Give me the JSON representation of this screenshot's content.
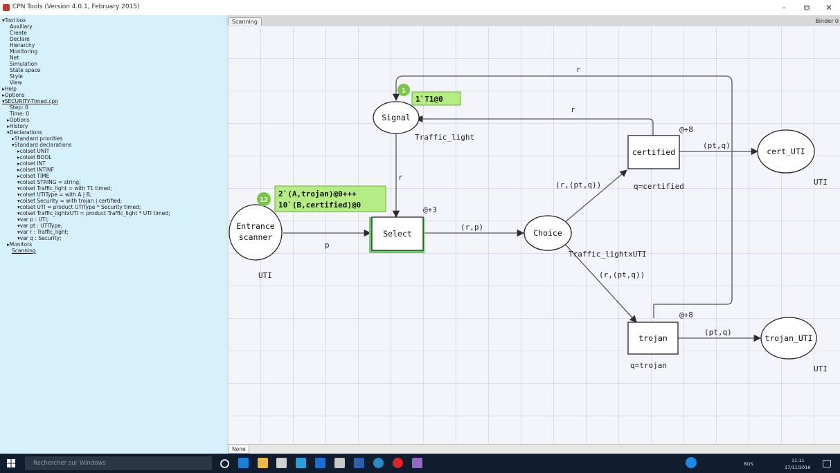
{
  "window": {
    "title": "CPN Tools (Version 4.0.1, February 2015)"
  },
  "sidebar": {
    "items": [
      "▾Tool box",
      "Auxiliary",
      "Create",
      "Declare",
      "Hierarchy",
      "Monitoring",
      "Net",
      "Simulation",
      "State space",
      "Style",
      "View",
      "▸Help",
      "▸Options",
      "▾SECURITY-Timed.cpn",
      "Step: 0",
      "Time: 0",
      "▸Options",
      "▸History",
      "▾Declarations",
      "▸Standard priorities",
      "▾Standard declarations",
      "▸colset UNIT",
      "▸colset BOOL",
      "▸colset INT",
      "▸colset INTINF",
      "▸colset TIME",
      "▾colset STRING = string;",
      "▾colset Traffic_light = with T1 timed;",
      "▾colset UTIType = with A | B;",
      "▾colset Security = with trojan | certified;",
      "▾colset UTI = product UTIType * Security timed;",
      "▾colset Traffic_lightxUTI = product Traffic_light * UTI timed;",
      "▾var p : UTI;",
      "▾var pt : UTIType;",
      "▾var r : Traffic_light;",
      "▾var q : Security;",
      "▸Monitors",
      "Scanning"
    ]
  },
  "tabs": {
    "active": "Scanning",
    "right": "Binder 0",
    "bottom": "None"
  },
  "net": {
    "places": {
      "signal": "Signal",
      "entrance_line1": "Entrance",
      "entrance_line2": "scanner",
      "choice": "Choice",
      "cert": "cert_UTI",
      "trojan": "trojan_UTI"
    },
    "transitions": {
      "select": "Select",
      "certified": "certified",
      "trojan": "trojan"
    },
    "color_sets": {
      "signal": "Traffic_light",
      "entrance": "UTI",
      "choice": "Traffic_lightxUTI",
      "cert": "UTI",
      "trojan": "UTI"
    },
    "delays": {
      "select": "@+3",
      "certified": "@+8",
      "trojan": "@+8"
    },
    "guards": {
      "certified": "q=certified",
      "trojan": "q=trojan"
    },
    "arc_labels": {
      "top_loop": "r",
      "cert_to_signal": "r",
      "signal_to_select": "r",
      "entrance_to_select": "p",
      "select_to_choice": "(r,p)",
      "choice_to_certified": "(r,(pt,q))",
      "choice_to_trojan": "(r,(pt,q))",
      "certified_to_cert": "(pt,q)",
      "trojan_to_trojanuti": "(pt,q)"
    },
    "tokens": {
      "signal_count": "1",
      "signal_marking": "1`T1@0",
      "entrance_count": "12",
      "entrance_marking_line1": "2`(A,trojan)@0+++",
      "entrance_marking_line2": "10`(B,certified)@0"
    }
  },
  "taskbar": {
    "search_placeholder": "Rechercher sur Windows",
    "time": "11:11",
    "date": "17/11/2016",
    "tray": "BOS"
  },
  "colors": {
    "sidebar_bg": "#d6f0fc",
    "token_green": "#7bc64a",
    "enabled_green": "#5fd35f",
    "taskbar": "#101d2e"
  }
}
